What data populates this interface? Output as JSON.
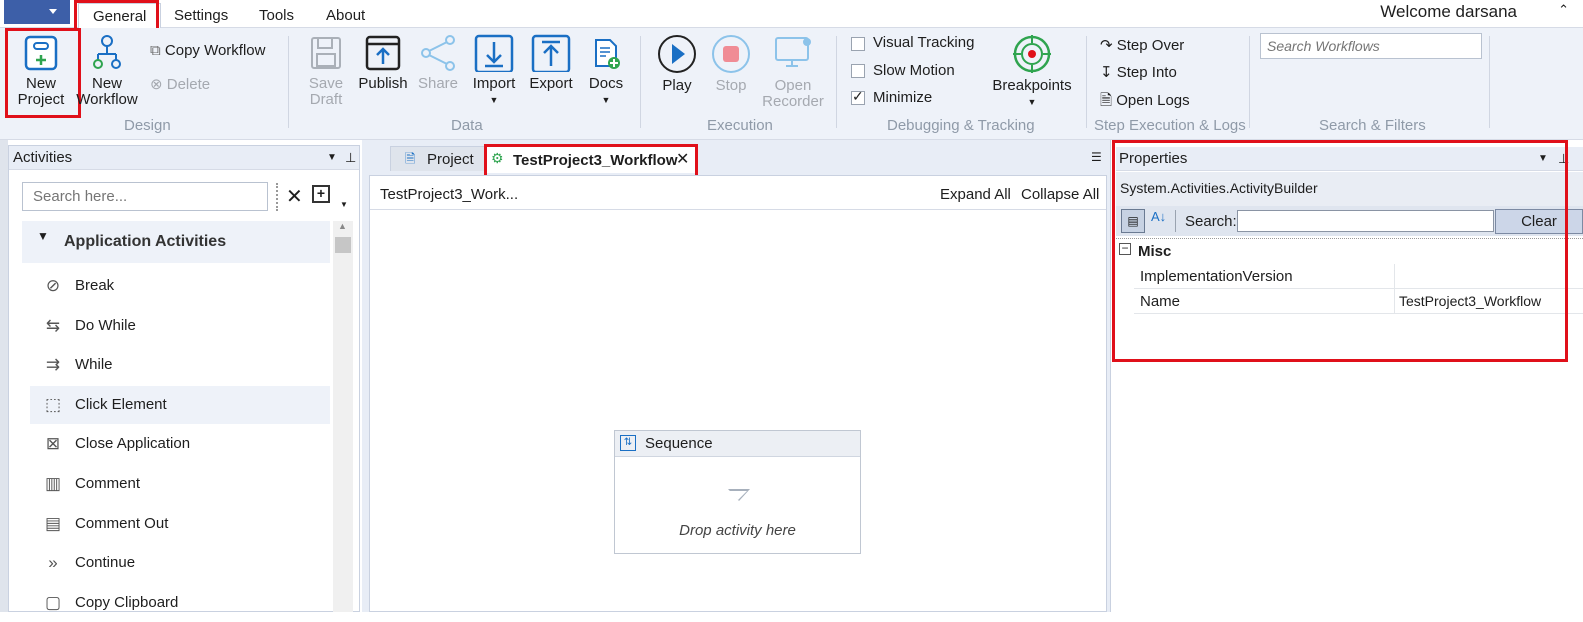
{
  "menubar": {
    "tabs": [
      "General",
      "Settings",
      "Tools",
      "About"
    ],
    "welcome": "Welcome  darsana"
  },
  "ribbon": {
    "new_project": [
      "New",
      "Project"
    ],
    "new_workflow": [
      "New",
      "Workflow"
    ],
    "copy_workflow": "Copy Workflow",
    "delete": "Delete",
    "save_draft": [
      "Save",
      "Draft"
    ],
    "publish": "Publish",
    "share": "Share",
    "import": "Import",
    "export": "Export",
    "docs": "Docs",
    "play": "Play",
    "stop": "Stop",
    "open_recorder": [
      "Open",
      "Recorder"
    ],
    "visual_tracking": "Visual Tracking",
    "slow_motion": "Slow Motion",
    "minimize": "Minimize",
    "breakpoints": "Breakpoints",
    "step_over": "Step Over",
    "step_into": "Step Into",
    "open_logs": "Open Logs",
    "search_placeholder": "Search Workflows",
    "groups": [
      "Design",
      "Data",
      "Execution",
      "Debugging & Tracking",
      "Step Execution & Logs",
      "Search & Filters"
    ],
    "checks": {
      "visual_tracking": false,
      "slow_motion": false,
      "minimize": true
    }
  },
  "activities": {
    "title": "Activities",
    "search_placeholder": "Search here...",
    "category": "Application Activities",
    "items": [
      "Break",
      "Do While",
      "While",
      "Click Element",
      "Close Application",
      "Comment",
      "Comment Out",
      "Continue",
      "Copy Clipboard"
    ],
    "icons": [
      "ban-icon",
      "do-while-icon",
      "while-icon",
      "click-element-icon",
      "close-application-icon",
      "comment-icon",
      "comment-out-icon",
      "continue-icon",
      "copy-clipboard-icon"
    ]
  },
  "editor": {
    "tabs": [
      "Project",
      "TestProject3_Workflow"
    ],
    "breadcrumb": "TestProject3_Work...",
    "expand_all": "Expand All",
    "collapse_all": "Collapse All",
    "sequence_title": "Sequence",
    "drop_hint": "Drop activity here"
  },
  "properties": {
    "title": "Properties",
    "type_name": "System.Activities.ActivityBuilder",
    "search_label": "Search:",
    "clear": "Clear",
    "category": "Misc",
    "rows": [
      {
        "name": "ImplementationVersion",
        "value": ""
      },
      {
        "name": "Name",
        "value": "TestProject3_Workflow"
      }
    ]
  },
  "colors": {
    "accent": "#1a6fc4",
    "highlight": "#e0101a",
    "ribbon_bg": "#eef2f9"
  }
}
